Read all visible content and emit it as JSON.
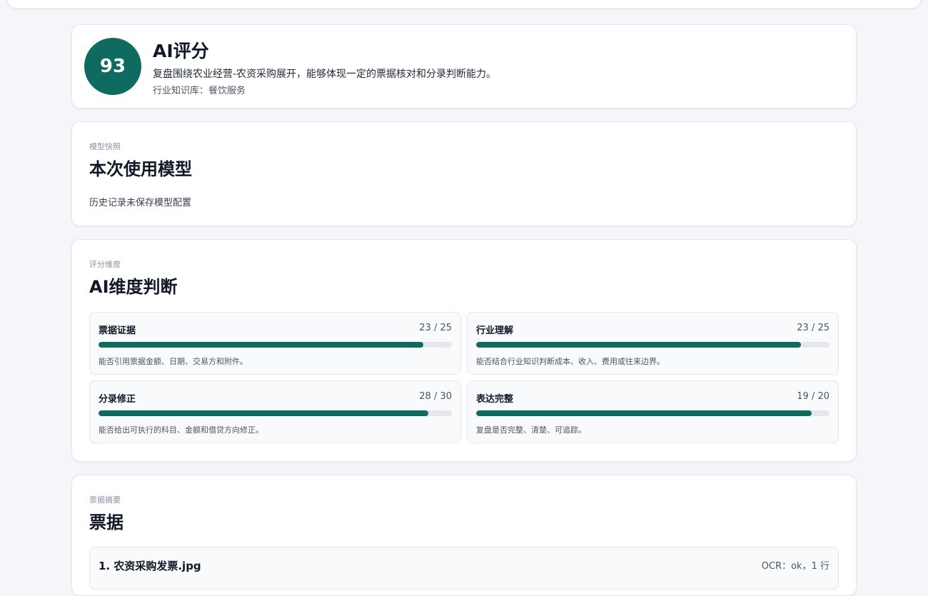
{
  "score": {
    "value": "93",
    "title": "AI评分",
    "summary": "复盘围绕农业经营-农资采购展开，能够体现一定的票据核对和分录判断能力。",
    "knowledge_base": "行业知识库：餐饮服务"
  },
  "model": {
    "eyebrow": "模型快照",
    "title": "本次使用模型",
    "note": "历史记录未保存模型配置"
  },
  "dimensions": {
    "eyebrow": "评分维度",
    "title": "AI维度判断",
    "items": [
      {
        "name": "票据证据",
        "score_text": "23 / 25",
        "score": 23,
        "max": 25,
        "desc": "能否引用票据金额、日期、交易方和附件。"
      },
      {
        "name": "行业理解",
        "score_text": "23 / 25",
        "score": 23,
        "max": 25,
        "desc": "能否结合行业知识判断成本、收入、费用或往来边界。"
      },
      {
        "name": "分录修正",
        "score_text": "28 / 30",
        "score": 28,
        "max": 30,
        "desc": "能否给出可执行的科目、金额和借贷方向修正。"
      },
      {
        "name": "表达完整",
        "score_text": "19 / 20",
        "score": 19,
        "max": 20,
        "desc": "复盘是否完整、清楚、可追踪。"
      }
    ]
  },
  "receipts": {
    "eyebrow": "票据摘要",
    "title": "票据",
    "items": [
      {
        "name": "1. 农资采购发票.jpg",
        "ocr": "OCR：ok，1 行"
      }
    ]
  },
  "colors": {
    "accent": "#0f6b5f",
    "track": "#e5e7eb",
    "background": "#f4f6f9"
  }
}
